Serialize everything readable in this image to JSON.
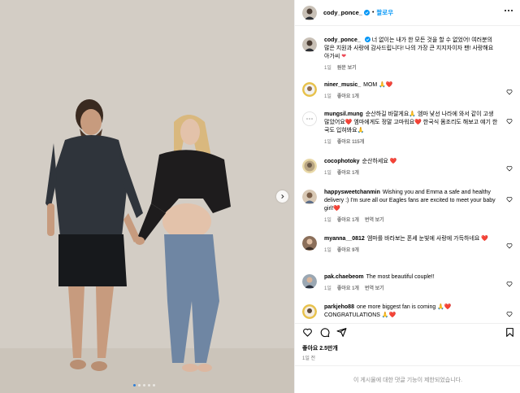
{
  "post": {
    "username": "cody_ponce_",
    "follow_label": "팔로우",
    "caption": "너 없이는 내가 한 모든 것을 할 수 없었어! 여러분의 많은 지원과 사랑에 감사드립니다! 나의 가장 큰 지지자이자 팬! 사랑해요 아가씨",
    "caption_time": "1일",
    "caption_translate": "원문 보기",
    "likes": "좋아요 2.5만개",
    "date": "1일 전",
    "comments_disabled": "이 게시물에 대한 댓글 기능이 제한되었습니다.",
    "carousel": {
      "count": 5,
      "active": 1
    }
  },
  "comments": [
    {
      "username": "niner_music_",
      "text": "MOM 🙏❤️",
      "time": "1일",
      "likes": "좋아요 1개",
      "reply": ""
    },
    {
      "username": "mungsil.mung",
      "text": "순산하길 바랄게요🙏 엠마 낯선 나라에 와서 같이 고생많았어요❤️ 엠마에게도 정말 고마워요❤️ 한국식 몸조리도 해보고 얘기 한국도 입혀봐요🙏",
      "time": "1일",
      "likes": "좋아요 115개",
      "reply": ""
    },
    {
      "username": "cocophotoky",
      "text": "순산하세요 ❤️",
      "time": "1일",
      "likes": "좋아요 1개",
      "reply": ""
    },
    {
      "username": "happysweetchanmin",
      "text": "Wishing you and Emma a safe and healthy delivery :) I'm sure all our Eagles fans are excited to meet your baby girl!❤️",
      "time": "1일",
      "likes": "좋아요 1개",
      "reply": "번역 보기"
    },
    {
      "username": "myanna__0812",
      "text": "엠마를 바라보는 폰세 눈빛에 사랑에 가득하네요 ❤️",
      "time": "1일",
      "likes": "좋아요 9개",
      "reply": ""
    },
    {
      "username": "pak.chaebeom",
      "text": "The most beautiful couple!!",
      "time": "1일",
      "likes": "좋아요 1개",
      "reply": "번역 보기"
    },
    {
      "username": "parkjeho88",
      "text": "one more biggest fan is coming 🙏❤️ CONGRATULATIONS 🙏❤️",
      "time": "",
      "likes": "",
      "reply": ""
    }
  ],
  "icons": {
    "like": "heart-icon",
    "comment": "comment-icon",
    "share": "share-icon",
    "save": "bookmark-icon",
    "verified": "verified-badge-icon",
    "next": "chevron-right-icon"
  },
  "colors": {
    "accent": "#0095f6",
    "verified": "#0095f6",
    "muted": "#737373"
  }
}
